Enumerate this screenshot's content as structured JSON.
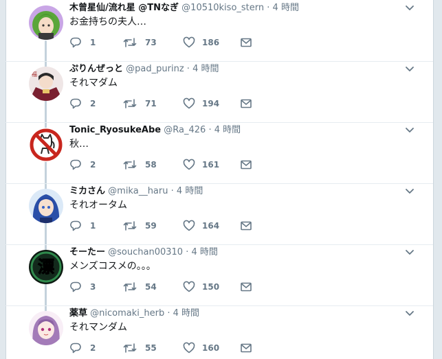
{
  "time_label": "4 時間",
  "tweets": [
    {
      "name": "木曾星仙/流れ星 @TNなぎ",
      "handle": "@10510kiso_stern",
      "text": "お金持ちの夫人…",
      "replies": "1",
      "retweets": "73",
      "likes": "186",
      "avatar": "green-hair-character-avatar"
    },
    {
      "name": "ぷりんぜっと",
      "handle": "@pad_purinz",
      "text": "それマダム",
      "replies": "2",
      "retweets": "71",
      "likes": "194",
      "avatar": "kimono-character-avatar"
    },
    {
      "name": "Tonic_RyosukeAbe",
      "handle": "@Ra_426",
      "text": "秋…",
      "replies": "2",
      "retweets": "58",
      "likes": "161",
      "avatar": "no-cat-sign-avatar"
    },
    {
      "name": "ミカさん",
      "handle": "@mika__haru",
      "text": "それオータム",
      "replies": "1",
      "retweets": "59",
      "likes": "164",
      "avatar": "blue-hair-character-avatar"
    },
    {
      "name": "そーたー",
      "handle": "@souchan00310",
      "text": "メンズコスメの。。。",
      "replies": "3",
      "retweets": "54",
      "likes": "150",
      "avatar": "kanji-emblem-avatar"
    },
    {
      "name": "薬草",
      "handle": "@nicomaki_herb",
      "text": "それマンダム",
      "replies": "2",
      "retweets": "55",
      "likes": "160",
      "avatar": "purple-hair-character-avatar"
    }
  ],
  "colors": {
    "accent": "#1da1f2",
    "muted": "#657786",
    "thread_line": "#c4d2dc",
    "divider": "#e6ecf0"
  }
}
